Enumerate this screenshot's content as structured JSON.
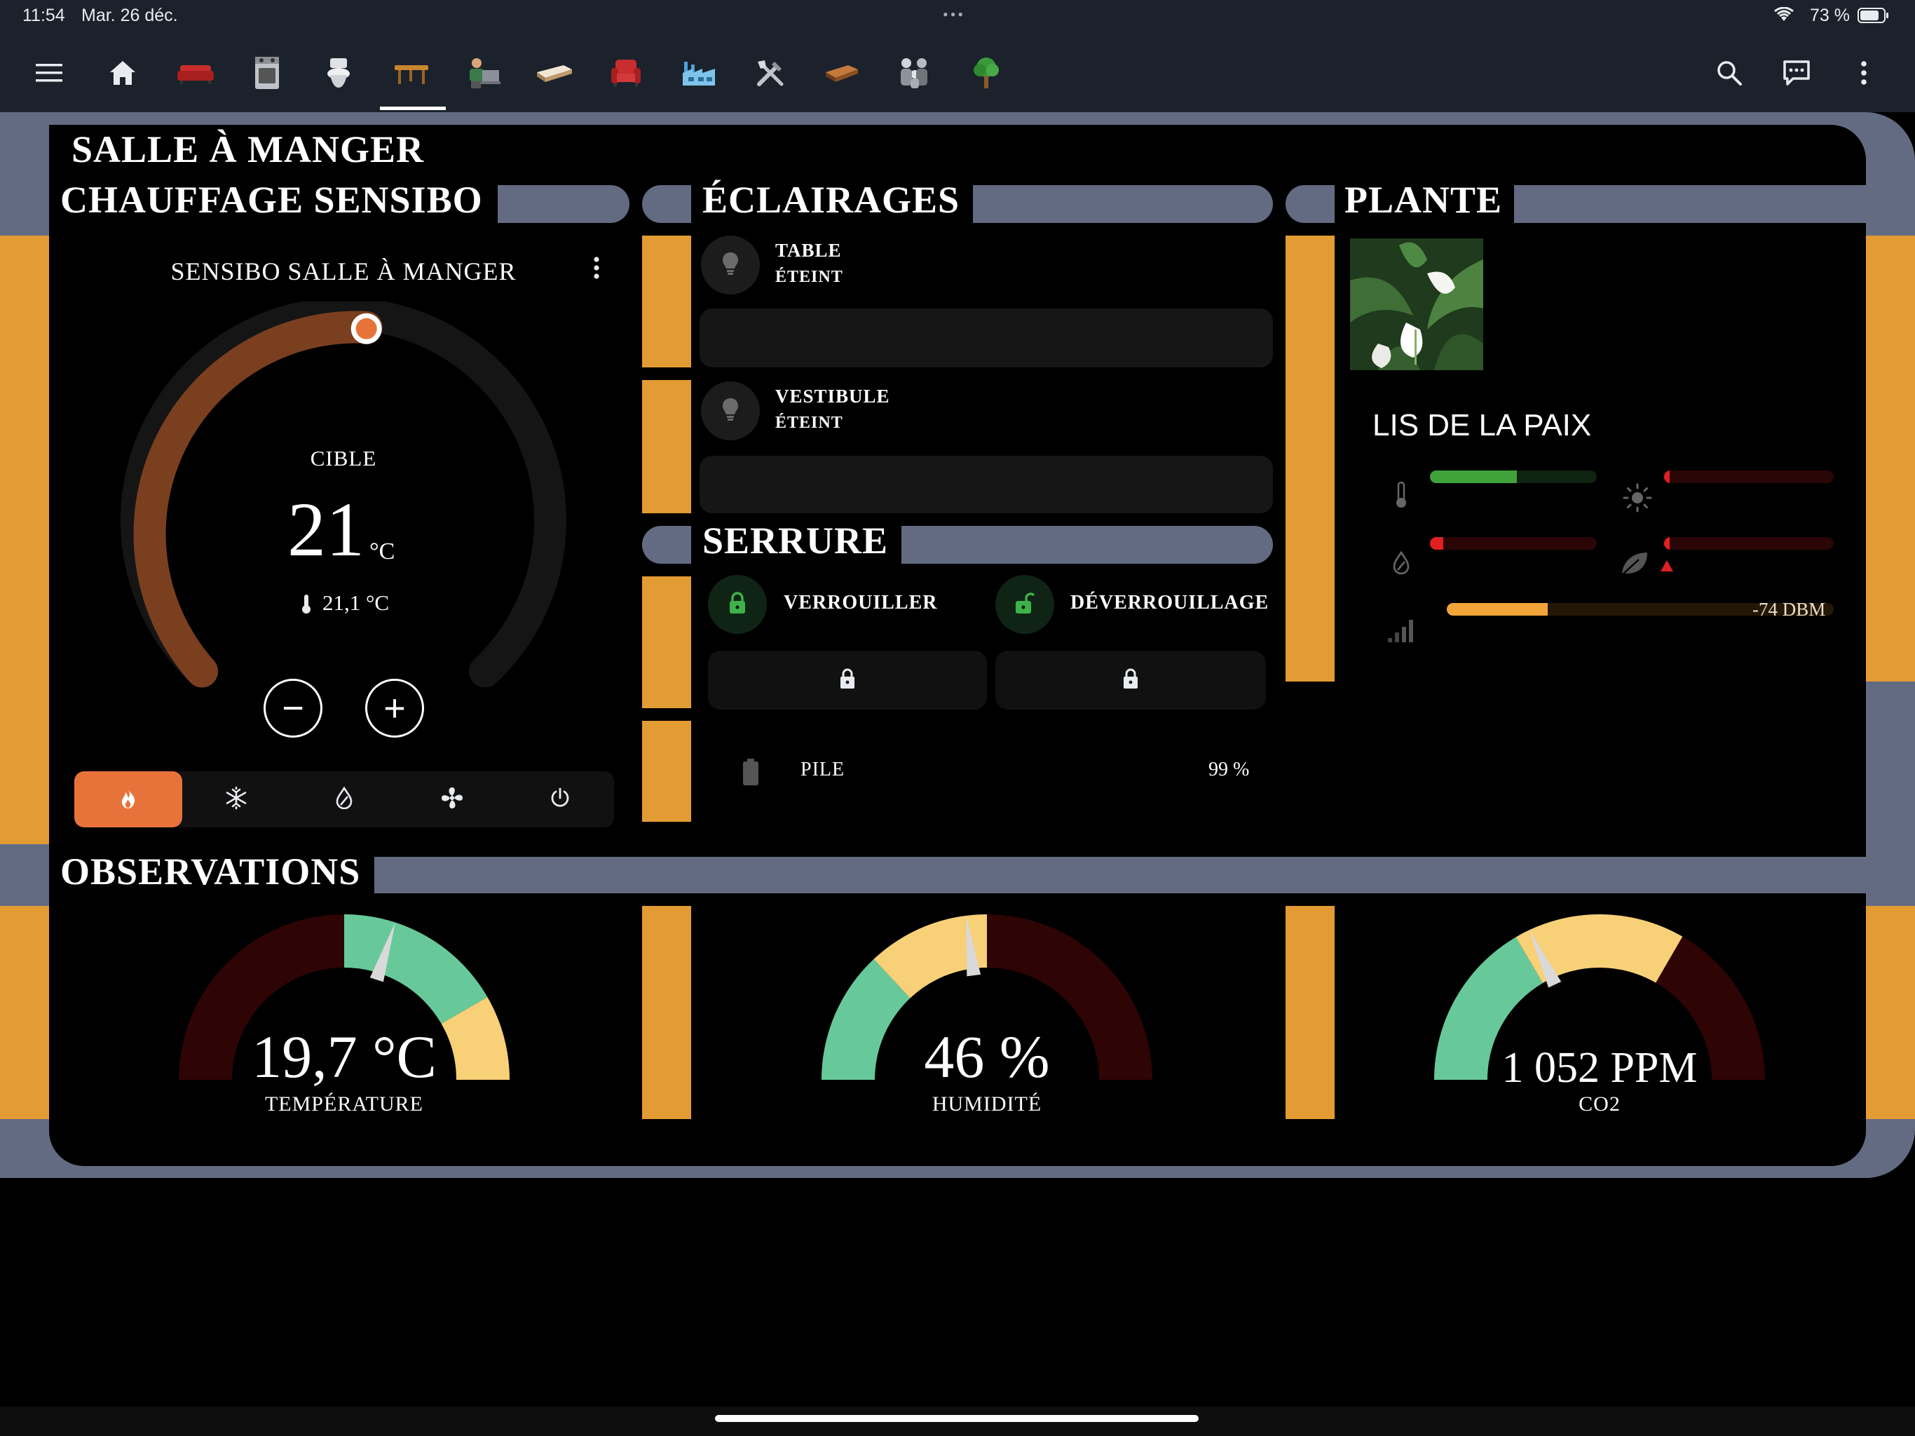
{
  "status_bar": {
    "time": "11:54",
    "date": "Mar. 26 déc.",
    "battery": "73 %",
    "icons": [
      "wifi-icon",
      "battery-icon"
    ]
  },
  "toolbar": {
    "icons": [
      "menu-icon",
      "home-icon",
      "sofa-icon",
      "stove-icon",
      "toilet-icon",
      "dining-table-icon",
      "office-icon",
      "bed-icon",
      "armchair-icon",
      "factory-icon",
      "tools-icon",
      "wood-icon",
      "family-icon",
      "tree-icon",
      "search-icon",
      "assist-icon",
      "more-vertical-icon"
    ],
    "active_tab": "dining-table-icon"
  },
  "room": {
    "title": "SALLE À MANGER"
  },
  "climate": {
    "header": "CHAUFFAGE SENSIBO",
    "card_title": "SENSIBO SALLE À MANGER",
    "target_label": "CIBLE",
    "target_value": "21",
    "unit": "°C",
    "current": "21,1 °C",
    "minus": "−",
    "plus": "+",
    "modes": [
      "heat",
      "cool",
      "dry",
      "fan",
      "off"
    ],
    "active_mode": "heat",
    "accent": "#e8733a"
  },
  "lights": {
    "header": "ÉCLAIRAGES",
    "items": [
      {
        "name": "TABLE",
        "state": "ÉTEINT"
      },
      {
        "name": "VESTIBULE",
        "state": "ÉTEINT"
      }
    ]
  },
  "lock": {
    "header": "SERRURE",
    "lock_label": "VERROUILLER",
    "unlock_label": "DÉVERROUILLAGE",
    "battery_label": "PILE",
    "battery_value": "99 %"
  },
  "plant": {
    "header": "PLANTE",
    "name": "LIS DE LA PAIX",
    "signal": "-74 DBM",
    "levels": {
      "temperature": 0.52,
      "light": 0.02,
      "moisture": 0.08,
      "fertility": 0.02,
      "signal": 0.26
    },
    "colors": {
      "good": "#3fa33a",
      "bad": "#e02020",
      "signal": "#f4a53a"
    }
  },
  "observations": {
    "header": "OBSERVATIONS",
    "gauges": [
      {
        "value": "19,7 °C",
        "label": "TEMPÉRATURE",
        "needle": 0.6
      },
      {
        "value": "46 %",
        "label": "HUMIDITÉ",
        "needle": 0.46
      },
      {
        "value": "1 052 PPM",
        "label": "CO2",
        "needle": 0.36
      }
    ]
  }
}
